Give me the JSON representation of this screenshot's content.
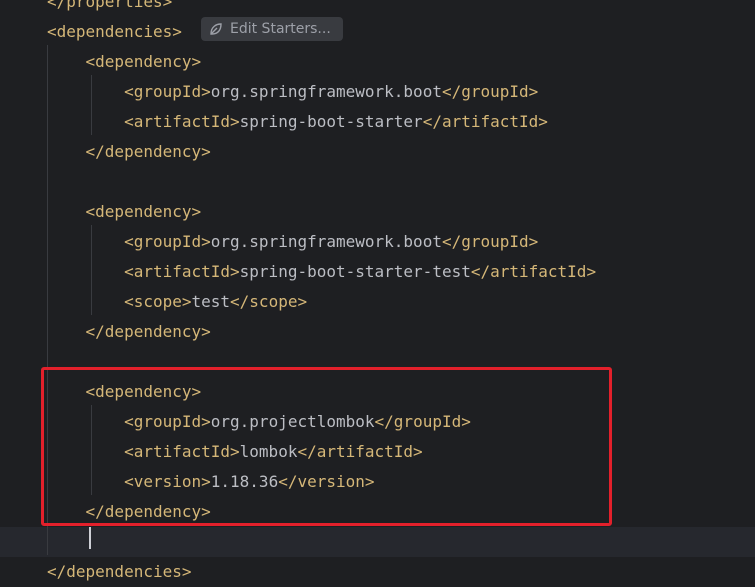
{
  "editor": {
    "lines": [
      {
        "indent": "",
        "open": "</properties>",
        "text": "",
        "close": ""
      },
      {
        "indent": "",
        "open": "<dependencies>",
        "text": "",
        "close": ""
      },
      {
        "indent": "    ",
        "open": "<dependency>",
        "text": "",
        "close": ""
      },
      {
        "indent": "        ",
        "open": "<groupId>",
        "text": "org.springframework.boot",
        "close": "</groupId>"
      },
      {
        "indent": "        ",
        "open": "<artifactId>",
        "text": "spring-boot-starter",
        "close": "</artifactId>"
      },
      {
        "indent": "    ",
        "open": "</dependency>",
        "text": "",
        "close": ""
      },
      {
        "indent": "",
        "open": "",
        "text": "",
        "close": ""
      },
      {
        "indent": "    ",
        "open": "<dependency>",
        "text": "",
        "close": ""
      },
      {
        "indent": "        ",
        "open": "<groupId>",
        "text": "org.springframework.boot",
        "close": "</groupId>"
      },
      {
        "indent": "        ",
        "open": "<artifactId>",
        "text": "spring-boot-starter-test",
        "close": "</artifactId>"
      },
      {
        "indent": "        ",
        "open": "<scope>",
        "text": "test",
        "close": "</scope>"
      },
      {
        "indent": "    ",
        "open": "</dependency>",
        "text": "",
        "close": ""
      },
      {
        "indent": "",
        "open": "",
        "text": "",
        "close": ""
      },
      {
        "indent": "    ",
        "open": "<dependency>",
        "text": "",
        "close": ""
      },
      {
        "indent": "        ",
        "open": "<groupId>",
        "text": "org.projectlombok",
        "close": "</groupId>"
      },
      {
        "indent": "        ",
        "open": "<artifactId>",
        "text": "lombok",
        "close": "</artifactId>"
      },
      {
        "indent": "        ",
        "open": "<version>",
        "text": "1.18.36",
        "close": "</version>"
      },
      {
        "indent": "    ",
        "open": "</dependency>",
        "text": "",
        "close": ""
      },
      {
        "indent": "",
        "open": "",
        "text": "",
        "close": ""
      },
      {
        "indent": "",
        "open": "</dependencies>",
        "text": "",
        "close": ""
      }
    ]
  },
  "inlay": {
    "label": "Edit Starters...",
    "icon": "spring-leaf-icon"
  },
  "colors": {
    "background": "#1e1f22",
    "tag": "#d5b778",
    "text": "#bcbec4",
    "highlight": "#e3202b"
  }
}
